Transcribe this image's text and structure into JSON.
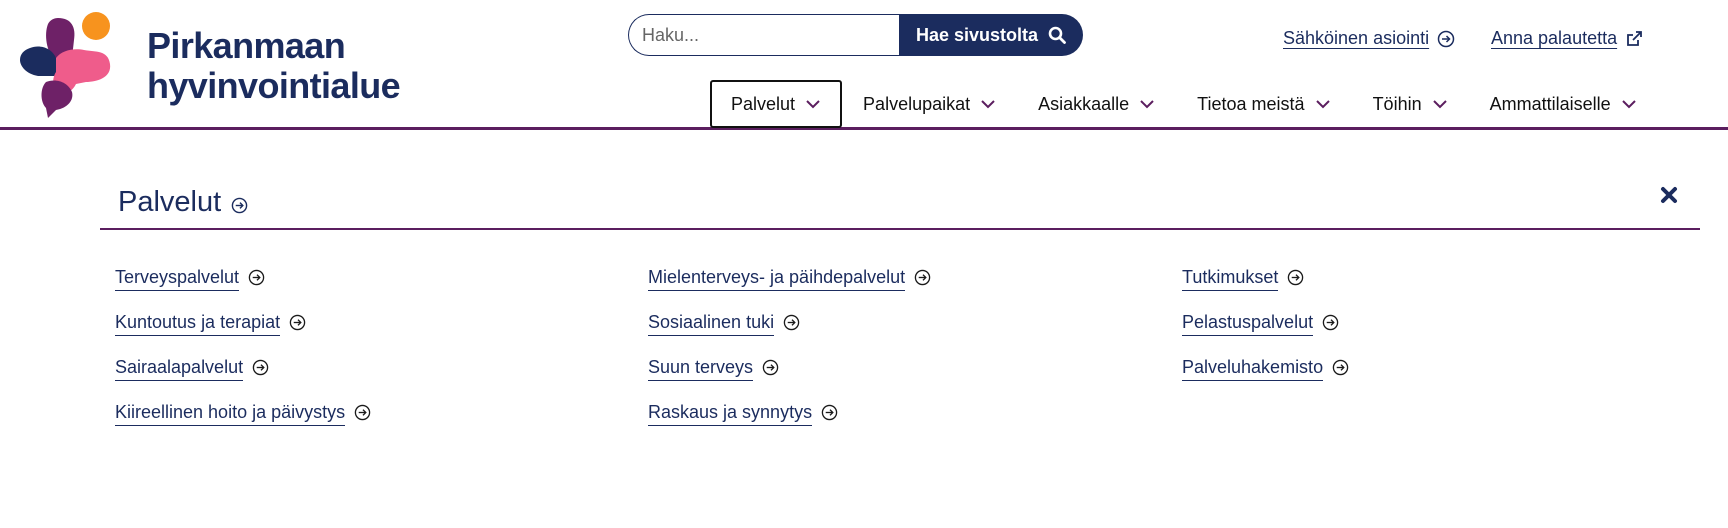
{
  "brand": {
    "line1": "Pirkanmaan",
    "line2": "hyvinvointialue"
  },
  "search": {
    "placeholder": "Haku...",
    "button_label": "Hae sivustolta"
  },
  "utility_links": [
    {
      "label": "Sähköinen asiointi",
      "icon": "arrow-circle-icon"
    },
    {
      "label": "Anna palautetta",
      "icon": "external-link-icon"
    }
  ],
  "nav": {
    "items": [
      {
        "label": "Palvelut",
        "active": true
      },
      {
        "label": "Palvelupaikat"
      },
      {
        "label": "Asiakkaalle"
      },
      {
        "label": "Tietoa meistä"
      },
      {
        "label": "Töihin"
      },
      {
        "label": "Ammattilaiselle"
      }
    ]
  },
  "dropdown": {
    "title": "Palvelut",
    "columns": [
      {
        "links": [
          "Terveyspalvelut",
          "Kuntoutus ja terapiat",
          "Sairaalapalvelut",
          "Kiireellinen hoito ja päivystys"
        ]
      },
      {
        "links": [
          "Mielenterveys- ja päihdepalvelut",
          "Sosiaalinen tuki",
          "Suun terveys",
          "Raskaus ja synnytys"
        ]
      },
      {
        "links": [
          "Tutkimukset",
          "Pelastuspalvelut",
          "Palveluhakemisto"
        ]
      }
    ]
  },
  "colors": {
    "primary": "#1b2c5e",
    "accent_purple": "#5b1e5f",
    "logo_orange": "#f7931e",
    "logo_pink": "#ef5c8b",
    "logo_purple": "#6e2167",
    "logo_navy": "#1b2c5e"
  }
}
